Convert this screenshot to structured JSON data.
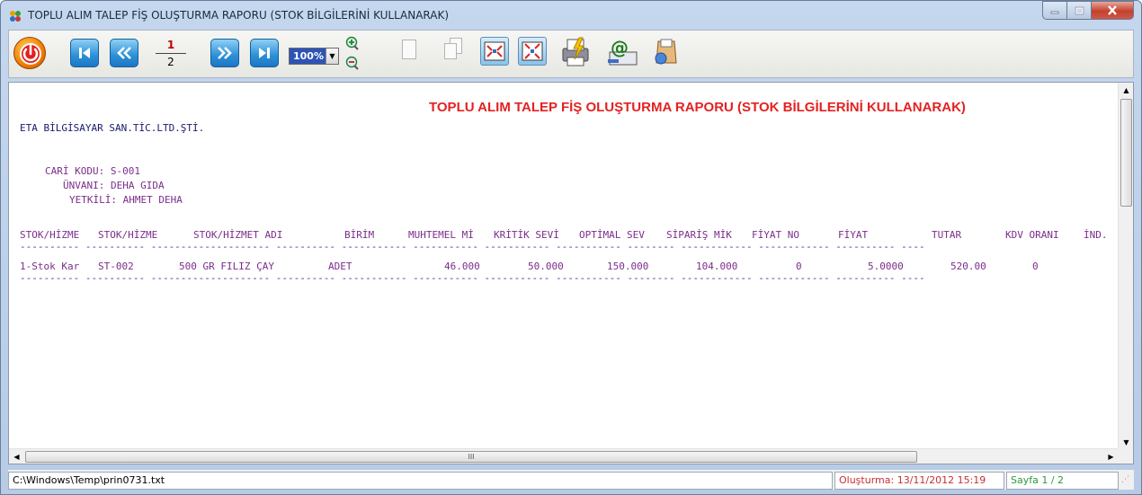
{
  "window": {
    "title": "TOPLU ALIM TALEP FİŞ OLUŞTURMA RAPORU (STOK BİLGİLERİNİ KULLANARAK)"
  },
  "toolbar": {
    "icons": [
      "power-icon",
      "first-page-icon",
      "previous-page-icon",
      "next-page-icon",
      "last-page-icon",
      "zoom-in-icon",
      "zoom-out-icon",
      "single-page-icon",
      "multi-page-icon",
      "fit-width-icon",
      "fit-page-icon",
      "print-icon",
      "email-icon",
      "save-icon"
    ],
    "current_page": "1",
    "total_pages": "2",
    "zoom": "100%"
  },
  "report": {
    "title": "TOPLU ALIM TALEP FİŞ OLUŞTURMA RAPORU (STOK BİLGİLERİNİ KULLANARAK)",
    "company": "ETA BİLGİSAYAR SAN.TİC.LTD.ŞTİ.",
    "cari_kodu": "CARİ KODU: S-001",
    "unvani": "ÜNVANI: DEHA GIDA",
    "yetkili": "YETKİLİ: AHMET DEHA",
    "columns": [
      "STOK/HİZME",
      "STOK/HİZME",
      "STOK/HİZMET ADI",
      "BİRİM",
      "MUHTEMEL Mİ",
      "KRİTİK SEVİ",
      "OPTİMAL SEV",
      "SİPARİŞ MİK",
      "FİYAT NO",
      "FİYAT",
      "TUTAR",
      "KDV ORANI",
      "İND."
    ],
    "separator": "---------- ---------- -------------------- ---------- ----------- ----------- ----------- ----------- -------- ------------ ------------ ---------- ----",
    "rows": [
      [
        "1-Stok Kar",
        "ST-002",
        "500 GR FILIZ ÇAY",
        "ADET",
        "46.000",
        "50.000",
        "150.000",
        "104.000",
        "0",
        "5.0000",
        "520.00",
        "0",
        ""
      ]
    ],
    "separator_bottom": "---------- ---------- -------------------- ---------- ----------- ----------- ----------- ----------- -------- ------------ ------------ ---------- ----"
  },
  "scroll": {
    "h_thumb_label": "III"
  },
  "status": {
    "path": "C:\\Windows\\Temp\\prin0731.txt",
    "created": "Oluşturma: 13/11/2012 15:19",
    "page": "Sayfa 1 / 2"
  },
  "colors": {
    "title_red": "#e32222",
    "text_purple": "#7b2e8a",
    "company_navy": "#1a1a6e",
    "status_red": "#c83030",
    "status_green": "#2a9a3a"
  }
}
